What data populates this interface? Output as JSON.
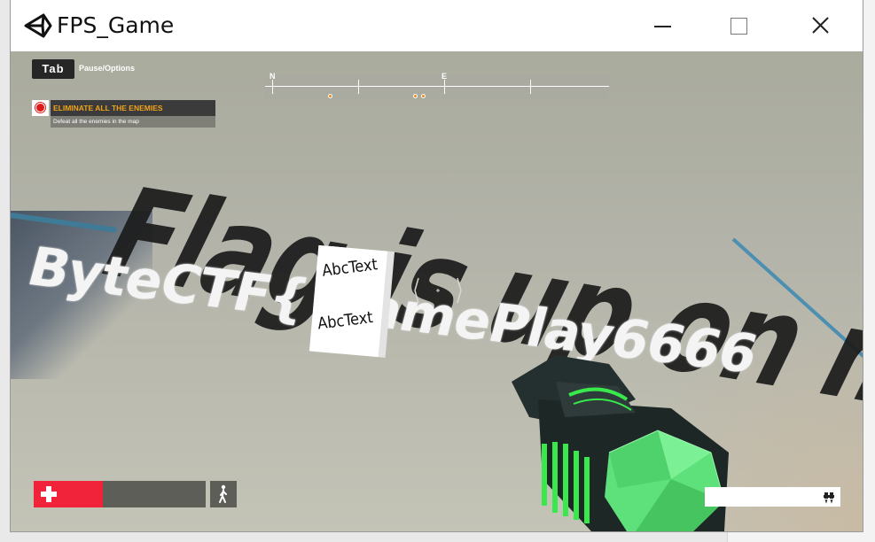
{
  "window": {
    "title": "FPS_Game"
  },
  "icons": {
    "app": "unity-logo-icon",
    "minimize": "minimize-icon",
    "maximize": "maximize-icon",
    "close": "close-icon",
    "health": "health-cross-icon",
    "stance": "walking-figure-icon",
    "jetpack": "jetpack-icon",
    "objective": "objective-target-icon"
  },
  "hud": {
    "tab_key": "Tab",
    "tab_hint": "Pause/Options",
    "compass": {
      "north_label": "N",
      "east_label": "E"
    },
    "objective": {
      "title": "ELIMINATE ALL THE ENEMIES",
      "description": "Defeat all the enemies in the map"
    },
    "health_fraction": 0.4,
    "jetpack_fraction": 1.0
  },
  "scene": {
    "floor_text": "Flag is up on me|",
    "flag_text": "ByteCTF{ GamePlay6666",
    "cube_text_top": "AbcText",
    "cube_text_bottom": "AbcText"
  },
  "colors": {
    "health_fill": "#f0233a",
    "health_bg": "#5d5e58",
    "objective_title": "#f0a31a",
    "weapon_glow": "#39e84a",
    "weapon_gem": "#5ee07a"
  }
}
